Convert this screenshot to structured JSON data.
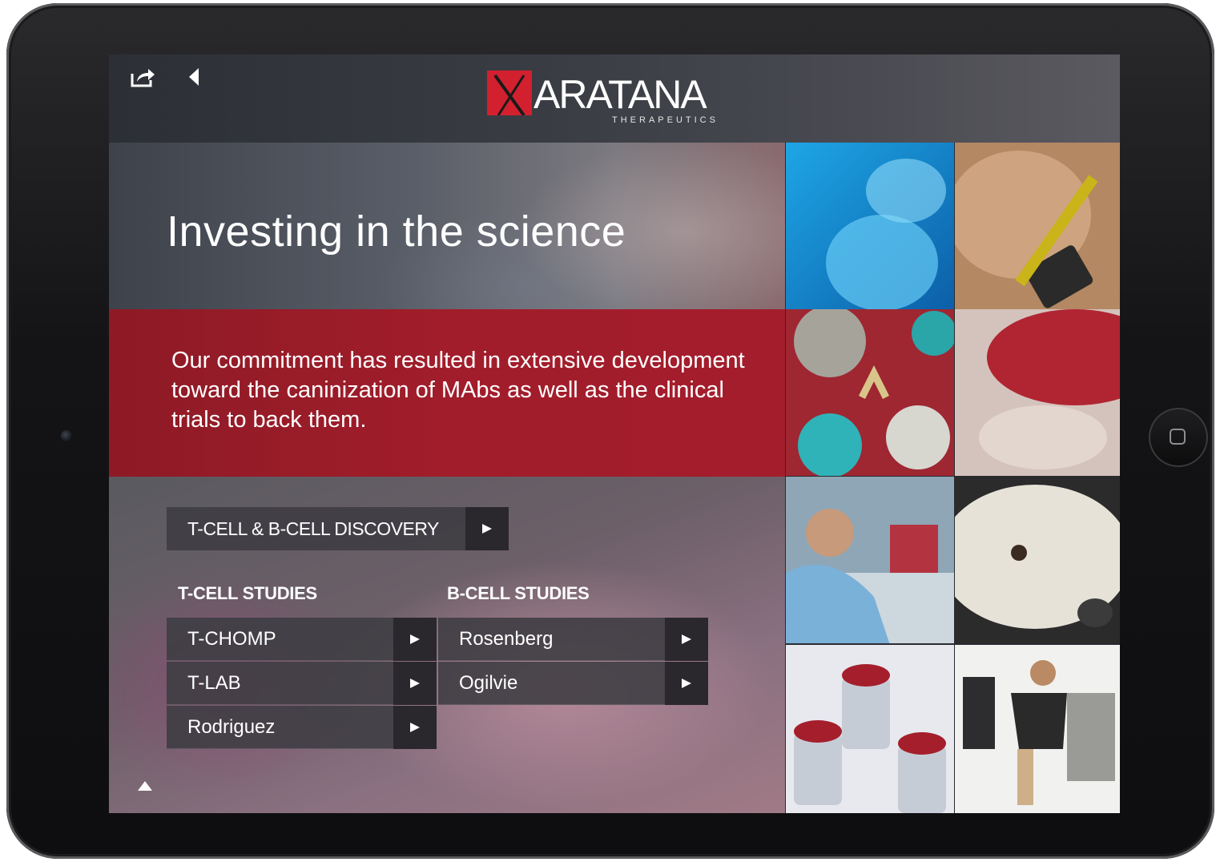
{
  "header": {
    "logo_word": "ARATANA",
    "logo_sub": "THERAPEUTICS"
  },
  "hero": {
    "title": "Investing in the science"
  },
  "intro": {
    "text": "Our commitment has resulted in extensive development toward the caninization of MAbs as well as the clinical trials to back them."
  },
  "discovery_button": {
    "label": "T-CELL & B-CELL DISCOVERY"
  },
  "t_cell": {
    "heading": "T-CELL STUDIES",
    "items": [
      {
        "label": "T-CHOMP"
      },
      {
        "label": "T-LAB"
      },
      {
        "label": "Rodriguez"
      }
    ]
  },
  "b_cell": {
    "heading": "B-CELL STUDIES",
    "items": [
      {
        "label": "Rosenberg"
      },
      {
        "label": "Ogilvie"
      }
    ]
  },
  "icons": {
    "share": "share-icon",
    "back": "back-arrow-icon",
    "play": "play-arrow-icon",
    "up": "up-caret-icon",
    "home": "home-button-icon"
  },
  "colors": {
    "brand_red": "#d2202f",
    "band_red": "#a11d2b"
  }
}
